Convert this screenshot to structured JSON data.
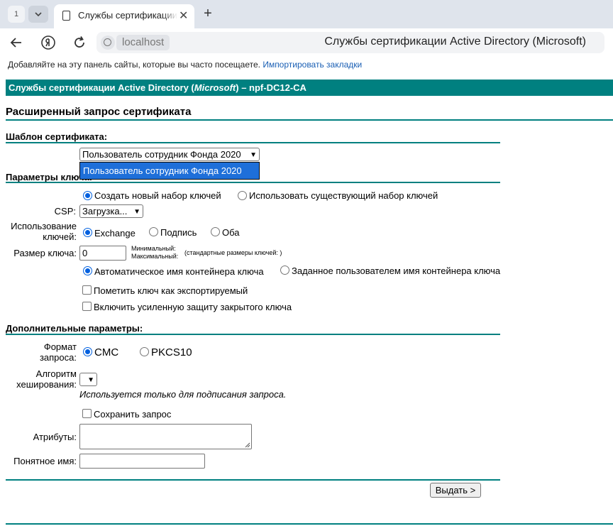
{
  "browser": {
    "tab_count": "1",
    "tab_title": "Службы сертификации Active Directory (Microsoft)",
    "address_host": "localhost",
    "address_title": "Службы сертификации Active Directory (Microsoft)",
    "bookmarks_hint": "Добавляйте на эту панель сайты, которые вы часто посещаете.",
    "bookmarks_link": "Импортировать закладки"
  },
  "header": {
    "prefix": "Службы сертификации Active Directory (",
    "ms": "Microsoft",
    "suffix": ")  –  npf-DC12-CA"
  },
  "page_title": "Расширенный запрос сертификата",
  "template_section": {
    "heading": "Шаблон сертификата:",
    "selected": "Пользователь сотрудник Фонда 2020",
    "dropdown_option": "Пользователь сотрудник Фонда 2020"
  },
  "key_section": {
    "heading": "Параметры ключа:",
    "radio_new": "Создать новый набор ключей",
    "radio_existing": "Использовать существующий набор ключей",
    "csp_label": "CSP:",
    "csp_value": "Загрузка...",
    "usage_label": "Использование ключей:",
    "usage_exchange": "Exchange",
    "usage_signature": "Подпись",
    "usage_both": "Оба",
    "size_label": "Размер ключа:",
    "size_value": "0",
    "min_label": "Минимальный:",
    "max_label": "Максимальный:",
    "standard_sizes": "(стандартные размеры ключей: )",
    "container_auto": "Автоматическое имя контейнера ключа",
    "container_user": "Заданное пользователем имя контейнера ключа",
    "mark_exportable": "Пометить ключ как экспортируемый",
    "strong_protection": "Включить усиленную защиту закрытого ключа"
  },
  "extra_section": {
    "heading": "Дополнительные параметры:",
    "format_label": "Формат запроса:",
    "format_cmc": "CMC",
    "format_pkcs10": "PKCS10",
    "hash_label": "Алгоритм хеширования:",
    "hash_note": "Используется только для подписания запроса.",
    "save_request": "Сохранить запрос",
    "attributes_label": "Атрибуты:",
    "friendly_label": "Понятное имя:"
  },
  "submit_label": "Выдать >"
}
